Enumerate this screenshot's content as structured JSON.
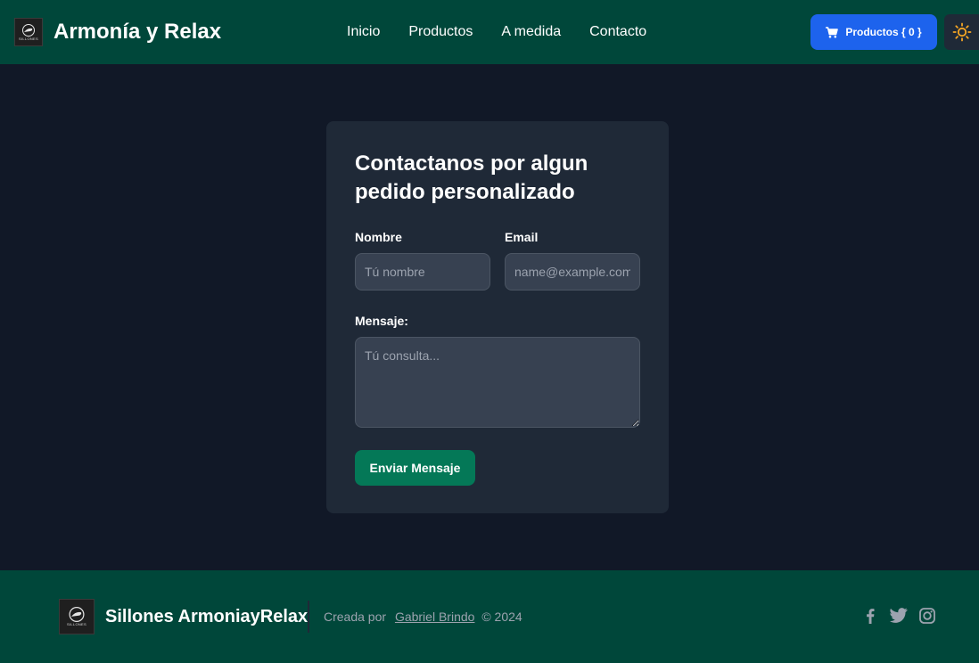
{
  "header": {
    "brand_title": "Armonía y Relax",
    "logo_text": "SILLONES",
    "nav": [
      "Inicio",
      "Productos",
      "A medida",
      "Contacto"
    ],
    "cart_label": "Productos { 0 }",
    "cart_icon": "cart-icon",
    "theme_icon": "sun-icon"
  },
  "form": {
    "title": "Contactanos por algun pedido personalizado",
    "name_label": "Nombre",
    "name_placeholder": "Tú nombre",
    "email_label": "Email",
    "email_placeholder": "name@example.com",
    "message_label": "Mensaje:",
    "message_placeholder": "Tú consulta...",
    "submit_label": "Enviar Mensaje"
  },
  "footer": {
    "brand_title": "Sillones ArmoniayRelax",
    "logo_text": "SILLONES",
    "credit_prefix": "Creada por",
    "author": "Gabriel Brindo",
    "copyright": "© 2024",
    "socials": [
      "facebook-icon",
      "twitter-icon",
      "instagram-icon"
    ]
  },
  "colors": {
    "header_bg": "#00473a",
    "page_bg": "#111827",
    "card_bg": "#1f2937",
    "cart_button": "#1d63ed",
    "submit_button": "#047857",
    "sun_icon": "#f6a623"
  }
}
